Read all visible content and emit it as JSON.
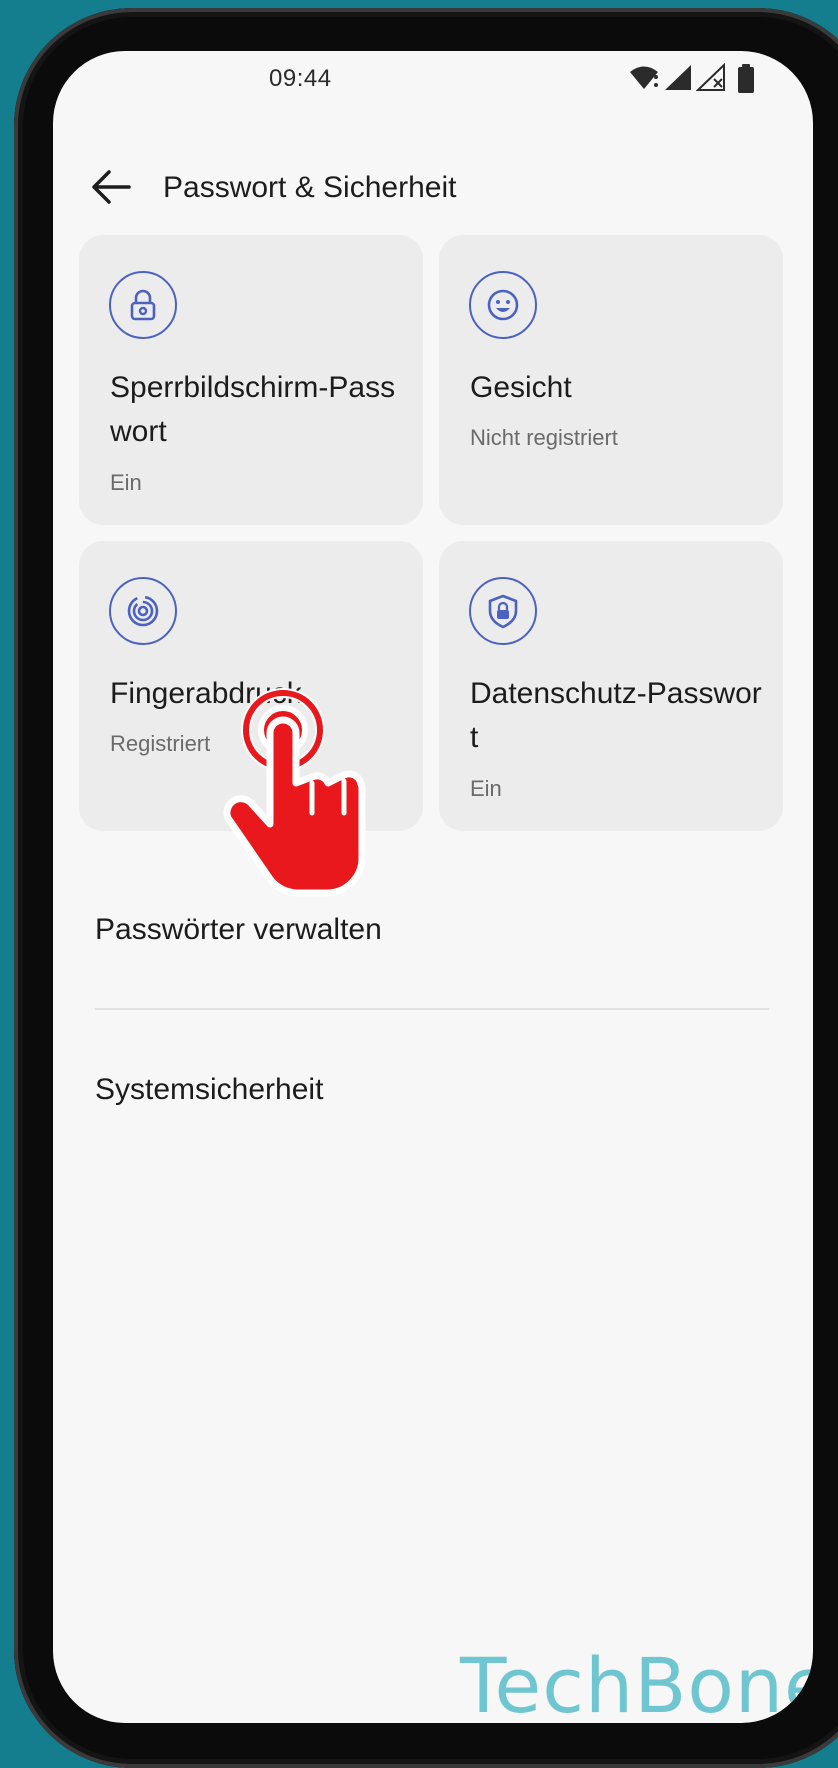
{
  "status_bar": {
    "time": "09:44",
    "icons": [
      "wifi-icon",
      "signal-icon",
      "signal-no-sim-icon",
      "battery-icon"
    ]
  },
  "header": {
    "title": "Passwort & Sicherheit",
    "back_icon": "arrow-left-icon"
  },
  "tiles": [
    {
      "title": "Sperrbildschirm-Passwort",
      "status": "Ein",
      "icon": "lock-icon"
    },
    {
      "title": "Gesicht",
      "status": "Nicht registriert",
      "icon": "face-icon"
    },
    {
      "title": "Fingerabdruck",
      "status": "Registriert",
      "icon": "fingerprint-icon"
    },
    {
      "title": "Datenschutz-Passwort",
      "status": "Ein",
      "icon": "shield-lock-icon"
    }
  ],
  "list": {
    "manage_passwords": "Passwörter verwalten",
    "system_security": "Systemsicherheit"
  },
  "overlay": {
    "tap_indicator_icon": "tap-hand-icon",
    "watermark": "TechBone"
  },
  "colors": {
    "background": "#147e8f",
    "screen": "#f7f7f7",
    "tile": "#ececec",
    "accent": "#4c62c2",
    "tap_indicator": "#e8181d",
    "watermark": "#6fc6d1"
  }
}
